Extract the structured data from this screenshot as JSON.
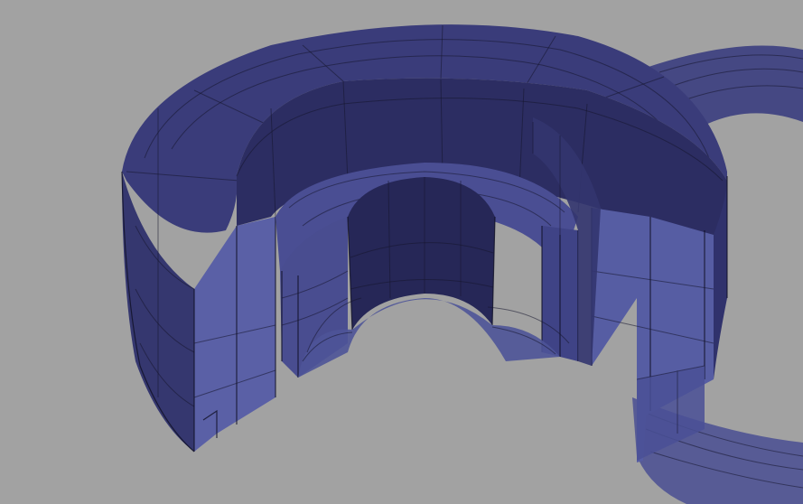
{
  "viewport": {
    "background_color": "#a2a2a2"
  },
  "model": {
    "shape": "sectioned concentric cylindrical rings (cutaway view)",
    "colors": {
      "shell_dark": "#2e2f66",
      "shell_mid": "#3b3d7c",
      "shell_light": "#545a9e",
      "cut_face": "#5c63a8",
      "edge_line": "#15152e"
    }
  }
}
